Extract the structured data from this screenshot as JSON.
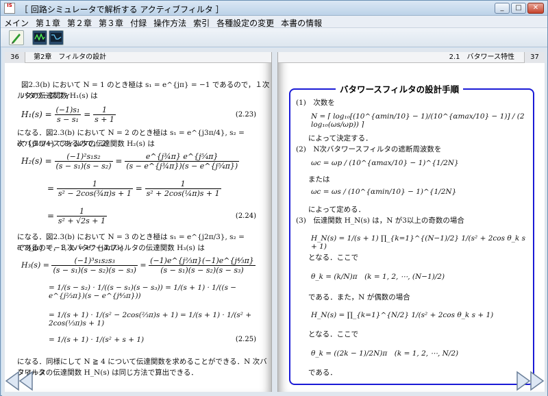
{
  "window": {
    "title": "［ 回路シミュレータで解析する アクティブフィルタ ］",
    "icon_text": "IS",
    "min": "_",
    "max": "□",
    "close": "✕"
  },
  "menu": [
    "メイン",
    "第１章",
    "第２章",
    "第３章",
    "付録",
    "操作方法",
    "索引",
    "各種設定の変更",
    "本書の情報"
  ],
  "toolbar": [
    "pen-icon",
    "scope-icon",
    "scope2-icon"
  ],
  "left_page": {
    "page_num": "36",
    "header": "第2章　フィルタの設計",
    "p1": "図2.3(b) において N = 1 のとき極は s₁ = e^{jπ} = −1 であるので，１次バタワースフィ",
    "p1b": "ルタの伝達関数 H₁(s) は",
    "eq1_lhs": "H₁(s) =",
    "eq1_n1": "(−1)s₁",
    "eq1_d1": "s − s₁",
    "eq1_eq": "=",
    "eq1_n2": "1",
    "eq1_d2": "s + 1",
    "eq1_no": "(2.23)",
    "p2": "になる．図2.3(b) において N = 2 のとき極は s₁ = e^{j3π/4}, s₂ = e^{j5π/4} であるので，２",
    "p2b": "次バタワースフィルタの伝達関数 H₂(s) は",
    "eq2_lhs": "H₂(s) =",
    "eq2_n1": "(−1)²s₁s₂",
    "eq2_d1": "(s − s₁)(s − s₂)",
    "eq2_n2": "e^{j¾π} e^{j⁵⁄₄π}",
    "eq2_d2": "(s − e^{j¾π})(s − e^{j⁵⁄₄π})",
    "eq2b_n1": "1",
    "eq2b_d1": "s² − 2cos(¾π)s + 1",
    "eq2b_n2": "1",
    "eq2b_d2": "s² + 2cos(¼π)s + 1",
    "eq2c_n": "1",
    "eq2c_d": "s² + √2s + 1",
    "eq2_no": "(2.24)",
    "p3": "になる．図2.3(b) において N = 3 のとき極は s₁ = e^{j2π/3}, s₂ = e^{jπ} = −1, s₃ = e^{j4π/3}",
    "p3b": "であるので，３次バタワースフィルタの伝達関数 H₃(s) は",
    "eq3_lhs": "H₃(s) =",
    "eq3_n1": "(−1)³s₁s₂s₃",
    "eq3_d1": "(s − s₁)(s − s₂)(s − s₃)",
    "eq3_n2": "(−1)e^{j⅔π}(−1)e^{j⁴⁄₃π}",
    "eq3_d2": "(s − s₁)(s − s₂)(s − s₃)",
    "eq3b": "= 1/(s − s₂) · 1/((s − s₁)(s − s₃)) = 1/(s + 1) · 1/((s − e^{j⅔π})(s − e^{j⁴⁄₃π}))",
    "eq3c": "= 1/(s + 1) · 1/(s² − 2cos(⅔π)s + 1) = 1/(s + 1) · 1/(s² + 2cos(⅓π)s + 1)",
    "eq3d": "= 1/(s + 1) · 1/(s² + s + 1)",
    "eq3_no": "(2.25)",
    "p4": "になる．同様にして N ≧ 4 について伝達関数を求めることができる．N 次バタワース",
    "p4b": "フィルタの伝達関数 H_N(s) は同じ方法で算出できる．"
  },
  "right_page": {
    "page_num": "37",
    "header": "2.1　バタワース特性",
    "box_title": "バタワースフィルタの設計手順",
    "s1": "(1)　次数を",
    "eqN": "N = ⌈ log₁₀[(10^{αmin/10} − 1)/(10^{αmax/10} − 1)] / (2 log₁₀(ωs/ωp)) ⌉",
    "s1b": "によって決定する．",
    "s2": "(2)　N次バタワースフィルタの遮断周波数を",
    "eqwc1": "ωc = ωp / (10^{αmax/10} − 1)^{1/2N}",
    "or": "または",
    "eqwc2": "ωc = ωs / (10^{αmin/10} − 1)^{1/2N}",
    "s2b": "によって定める．",
    "s3": "(3)　伝達関数 H_N(s) は，N が3以上の奇数の場合",
    "eqHodd": "H_N(s) = 1/(s + 1) ∏_{k=1}^{(N−1)/2} 1/(s² + 2cos θ_k s + 1)",
    "where1": "となる．ここで",
    "eqth1": "θ_k = (k/N)π　(k = 1, 2, ⋯, (N−1)/2)",
    "s3b": "である．また，N が偶数の場合",
    "eqHeven": "H_N(s) = ∏_{k=1}^{N/2} 1/(s² + 2cos θ_k s + 1)",
    "where2": "となる．ここで",
    "eqth2": "θ_k = ((2k − 1)/2N)π　(k = 1, 2, ⋯, N/2)",
    "end": "である．"
  },
  "nav": {
    "prev": "◁◁",
    "next": "▷▷"
  },
  "colors": {
    "box_border": "#1a1ad6",
    "accent": "#3aa6d6"
  }
}
